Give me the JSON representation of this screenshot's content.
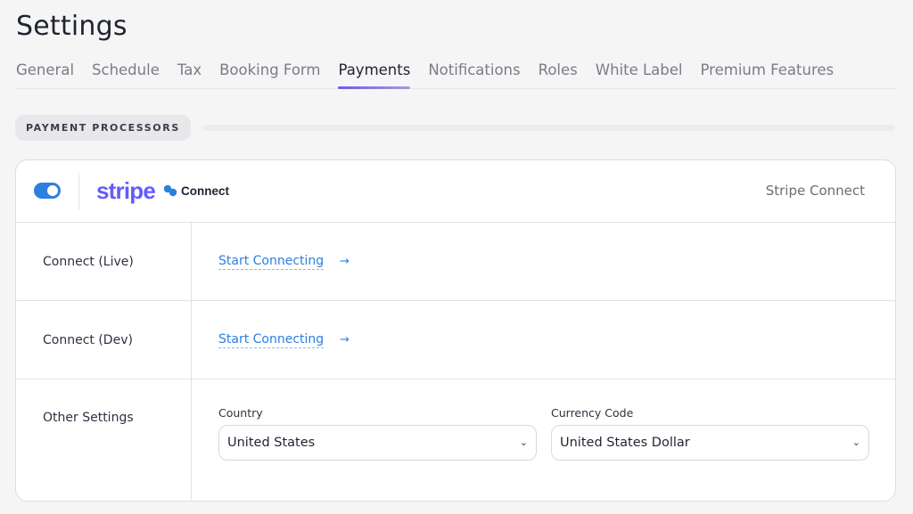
{
  "page": {
    "title": "Settings"
  },
  "tabs": [
    {
      "label": "General"
    },
    {
      "label": "Schedule"
    },
    {
      "label": "Tax"
    },
    {
      "label": "Booking Form"
    },
    {
      "label": "Payments"
    },
    {
      "label": "Notifications"
    },
    {
      "label": "Roles"
    },
    {
      "label": "White Label"
    },
    {
      "label": "Premium Features"
    }
  ],
  "active_tab": "Payments",
  "section": {
    "title": "PAYMENT PROCESSORS"
  },
  "processor": {
    "enabled": true,
    "logo_word": "stripe",
    "logo_suffix": "Connect",
    "name": "Stripe Connect",
    "rows": {
      "live": {
        "label": "Connect (Live)",
        "link": "Start Connecting",
        "arrow": "→"
      },
      "dev": {
        "label": "Connect (Dev)",
        "link": "Start Connecting",
        "arrow": "→"
      },
      "other": {
        "label": "Other Settings",
        "country": {
          "label": "Country",
          "value": "United States"
        },
        "currency": {
          "label": "Currency Code",
          "value": "United States Dollar"
        }
      }
    }
  },
  "icons": {
    "chevron": "chevron-down-icon",
    "link": "link-icon",
    "arrow": "arrow-right-icon"
  },
  "colors": {
    "accent": "#2d7fe0",
    "stripe": "#635bff",
    "tab_indicator": "#6c5ce7"
  }
}
